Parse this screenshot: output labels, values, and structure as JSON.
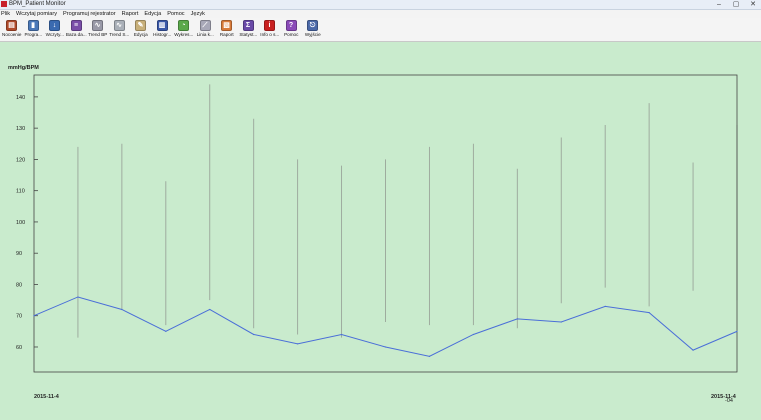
{
  "window": {
    "title": "BPM_Patient Monitor",
    "controls": [
      "–",
      "▢",
      "✕"
    ]
  },
  "menu": [
    "Plik",
    "Wczytaj pomiary",
    "Programuj rejestrator",
    "Raport",
    "Edycja",
    "Pomoc",
    "Język"
  ],
  "toolbar": [
    {
      "label": "Nocoenie",
      "icon": "notebook-icon",
      "color": "#b04a2a",
      "glyph": "▤"
    },
    {
      "label": "Progra...",
      "icon": "monitor-program-icon",
      "color": "#4a78b8",
      "glyph": "▮"
    },
    {
      "label": "Wczyty...",
      "icon": "download-icon",
      "color": "#3a6ab0",
      "glyph": "↓"
    },
    {
      "label": "Baza da...",
      "icon": "database-icon",
      "color": "#7a4ea8",
      "glyph": "≡"
    },
    {
      "label": "Trend BP",
      "icon": "trend-bp-icon",
      "color": "#9a9aa8",
      "glyph": "∿"
    },
    {
      "label": "Trend S...",
      "icon": "trend-s-icon",
      "color": "#aab0b8",
      "glyph": "∿"
    },
    {
      "label": "Edycja",
      "icon": "edit-icon",
      "color": "#c8b07a",
      "glyph": "✎"
    },
    {
      "label": "Histogr...",
      "icon": "histogram-icon",
      "color": "#3a58a8",
      "glyph": "▥"
    },
    {
      "label": "Wykres...",
      "icon": "pie-chart-icon",
      "color": "#5aa84a",
      "glyph": "◔"
    },
    {
      "label": "Linia k...",
      "icon": "line-chart-icon",
      "color": "#a8a8b8",
      "glyph": "⟋"
    },
    {
      "label": "Raport",
      "icon": "report-icon",
      "color": "#d87a3a",
      "glyph": "▧"
    },
    {
      "label": "Statyst...",
      "icon": "sigma-icon",
      "color": "#6a4aa8",
      "glyph": "Σ"
    },
    {
      "label": "Info o s...",
      "icon": "info-icon",
      "color": "#c82020",
      "glyph": "i"
    },
    {
      "label": "Pomoc",
      "icon": "help-book-icon",
      "color": "#8a4ab8",
      "glyph": "?"
    },
    {
      "label": "Wyjście",
      "icon": "exit-icon",
      "color": "#4a68a8",
      "glyph": "⎋"
    }
  ],
  "chart_data": {
    "type": "line",
    "ylabel": "mmHg/BPM",
    "ylim": [
      52,
      147
    ],
    "yticks": [
      60,
      70,
      80,
      90,
      100,
      110,
      120,
      130,
      140
    ],
    "grid": false,
    "x_start_label": "2015-11-4",
    "x_end_label": "2015-11-4",
    "x_end_extra": "-04",
    "colors": {
      "background": "#c9ebcd",
      "line": "#4a6ed8",
      "whisker": "#9aa59a",
      "axis": "#444444"
    },
    "points": [
      {
        "x": 0,
        "y": 70,
        "high": null,
        "low": null
      },
      {
        "x": 1,
        "y": 76,
        "high": 124,
        "low": 63
      },
      {
        "x": 2,
        "y": 72,
        "high": 125,
        "low": 72
      },
      {
        "x": 3,
        "y": 65,
        "high": 113,
        "low": 67
      },
      {
        "x": 4,
        "y": 72,
        "high": 144,
        "low": 75
      },
      {
        "x": 5,
        "y": 64,
        "high": 133,
        "low": 66
      },
      {
        "x": 6,
        "y": 61,
        "high": 120,
        "low": 64
      },
      {
        "x": 7,
        "y": 64,
        "high": 118,
        "low": 63
      },
      {
        "x": 8,
        "y": 60,
        "high": 120,
        "low": 68
      },
      {
        "x": 9,
        "y": 57,
        "high": 124,
        "low": 67
      },
      {
        "x": 10,
        "y": 64,
        "high": 125,
        "low": 67
      },
      {
        "x": 11,
        "y": 69,
        "high": 117,
        "low": 66
      },
      {
        "x": 12,
        "y": 68,
        "high": 127,
        "low": 74
      },
      {
        "x": 13,
        "y": 73,
        "high": 131,
        "low": 79
      },
      {
        "x": 14,
        "y": 71,
        "high": 138,
        "low": 73
      },
      {
        "x": 15,
        "y": 59,
        "high": 119,
        "low": 78
      },
      {
        "x": 16,
        "y": 65,
        "high": 131,
        "low": 75
      }
    ]
  }
}
